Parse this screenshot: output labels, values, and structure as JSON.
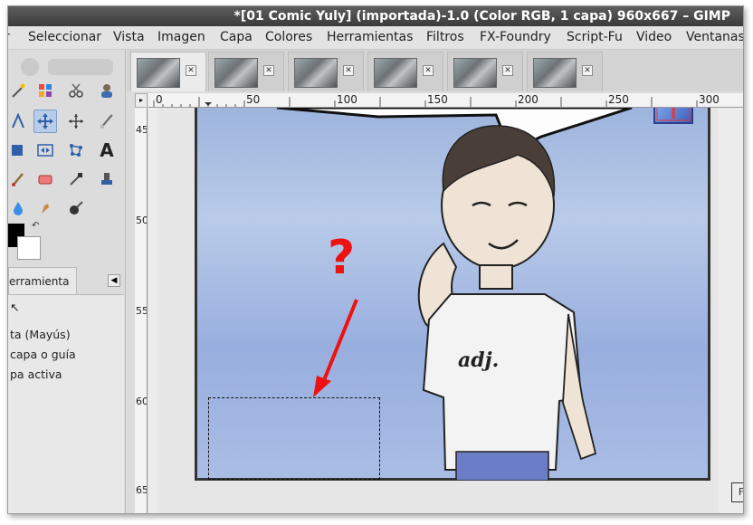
{
  "window": {
    "title": "*[01 Comic Yuly] (importada)-1.0 (Color RGB, 1 capa) 960x667 – GIMP"
  },
  "menubar": {
    "items": [
      "r",
      "Seleccionar",
      "Vista",
      "Imagen",
      "Capa",
      "Colores",
      "Herramientas",
      "Filtros",
      "FX-Foundry",
      "Script-Fu",
      "Video",
      "Ventanas"
    ]
  },
  "toolbox": {
    "tools": [
      "fuzzy-select",
      "select-by-color",
      "scissors-select",
      "foreground-select",
      "paths",
      "move",
      "align",
      "crop",
      "rotate",
      "flip",
      "cage-transform",
      "text",
      "paintbrush",
      "eraser",
      "color-picker",
      "clone",
      "blur",
      "smudge",
      "dodge-burn"
    ],
    "selected_tool": "move",
    "foreground_color": "#000000",
    "background_color": "#ffffff"
  },
  "tool_options": {
    "tab_label": "erramienta",
    "options": [
      "ta  (Mayús)",
      "capa o guía",
      "pa activa"
    ]
  },
  "image_tabs": {
    "active_index": 0
  },
  "rulers": {
    "horizontal_labels": [
      "0",
      "50",
      "100",
      "150",
      "200",
      "250",
      "300"
    ],
    "vertical_labels": [
      "450",
      "500",
      "550",
      "600",
      "650"
    ]
  },
  "canvas": {
    "question_mark": "?",
    "panel_letter": "F",
    "shirt_text": "adj."
  },
  "colors": {
    "annotation_red": "#ee1111",
    "selection_dash": "#111111",
    "active_tool_bg": "#b9cde8"
  }
}
